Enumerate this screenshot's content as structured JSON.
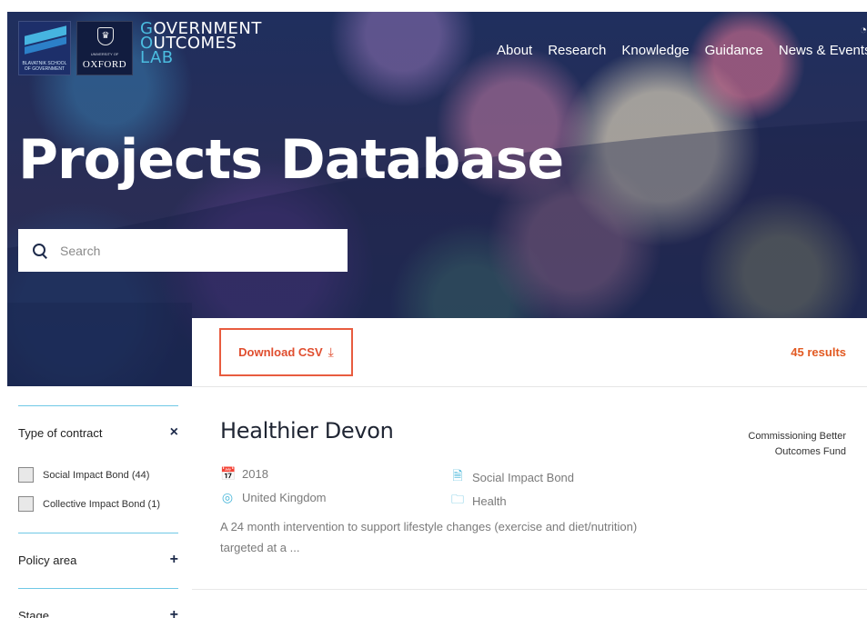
{
  "header": {
    "logos": {
      "bsg_text": "BLAVATNIK SCHOOL OF GOVERNMENT",
      "oxford_small": "UNIVERSITY OF",
      "oxford_name": "OXFORD",
      "golab_line1_accent": "G",
      "golab_line1_rest": "OVERNMENT",
      "golab_line2_accent": "O",
      "golab_line2_rest": "UTCOMES",
      "golab_line3": "LAB"
    },
    "nav": [
      "About",
      "Research",
      "Knowledge",
      "Guidance",
      "News & Events"
    ]
  },
  "hero": {
    "title": "Projects Database",
    "search_placeholder": "Search"
  },
  "toolbar": {
    "download_label": "Download CSV",
    "results": "45 results"
  },
  "sidebar": {
    "filters": [
      {
        "title": "Type of contract",
        "toggle": "×",
        "options": [
          "Social Impact Bond (44)",
          "Collective Impact Bond (1)"
        ]
      },
      {
        "title": "Policy area",
        "toggle": "+"
      },
      {
        "title": "Stage",
        "toggle": "+"
      }
    ]
  },
  "project": {
    "title": "Healthier Devon",
    "funder": "Commissioning Better Outcomes Fund",
    "year": "2018",
    "country": "United Kingdom",
    "contract_type": "Social Impact Bond",
    "policy_area": "Health",
    "description": "A 24 month intervention to support lifestyle changes (exercise and diet/nutrition) targeted at a ..."
  },
  "colors": {
    "accent_orange": "#e25a22",
    "accent_blue": "#47b6d9",
    "hero_navy": "#1f2f5e"
  }
}
